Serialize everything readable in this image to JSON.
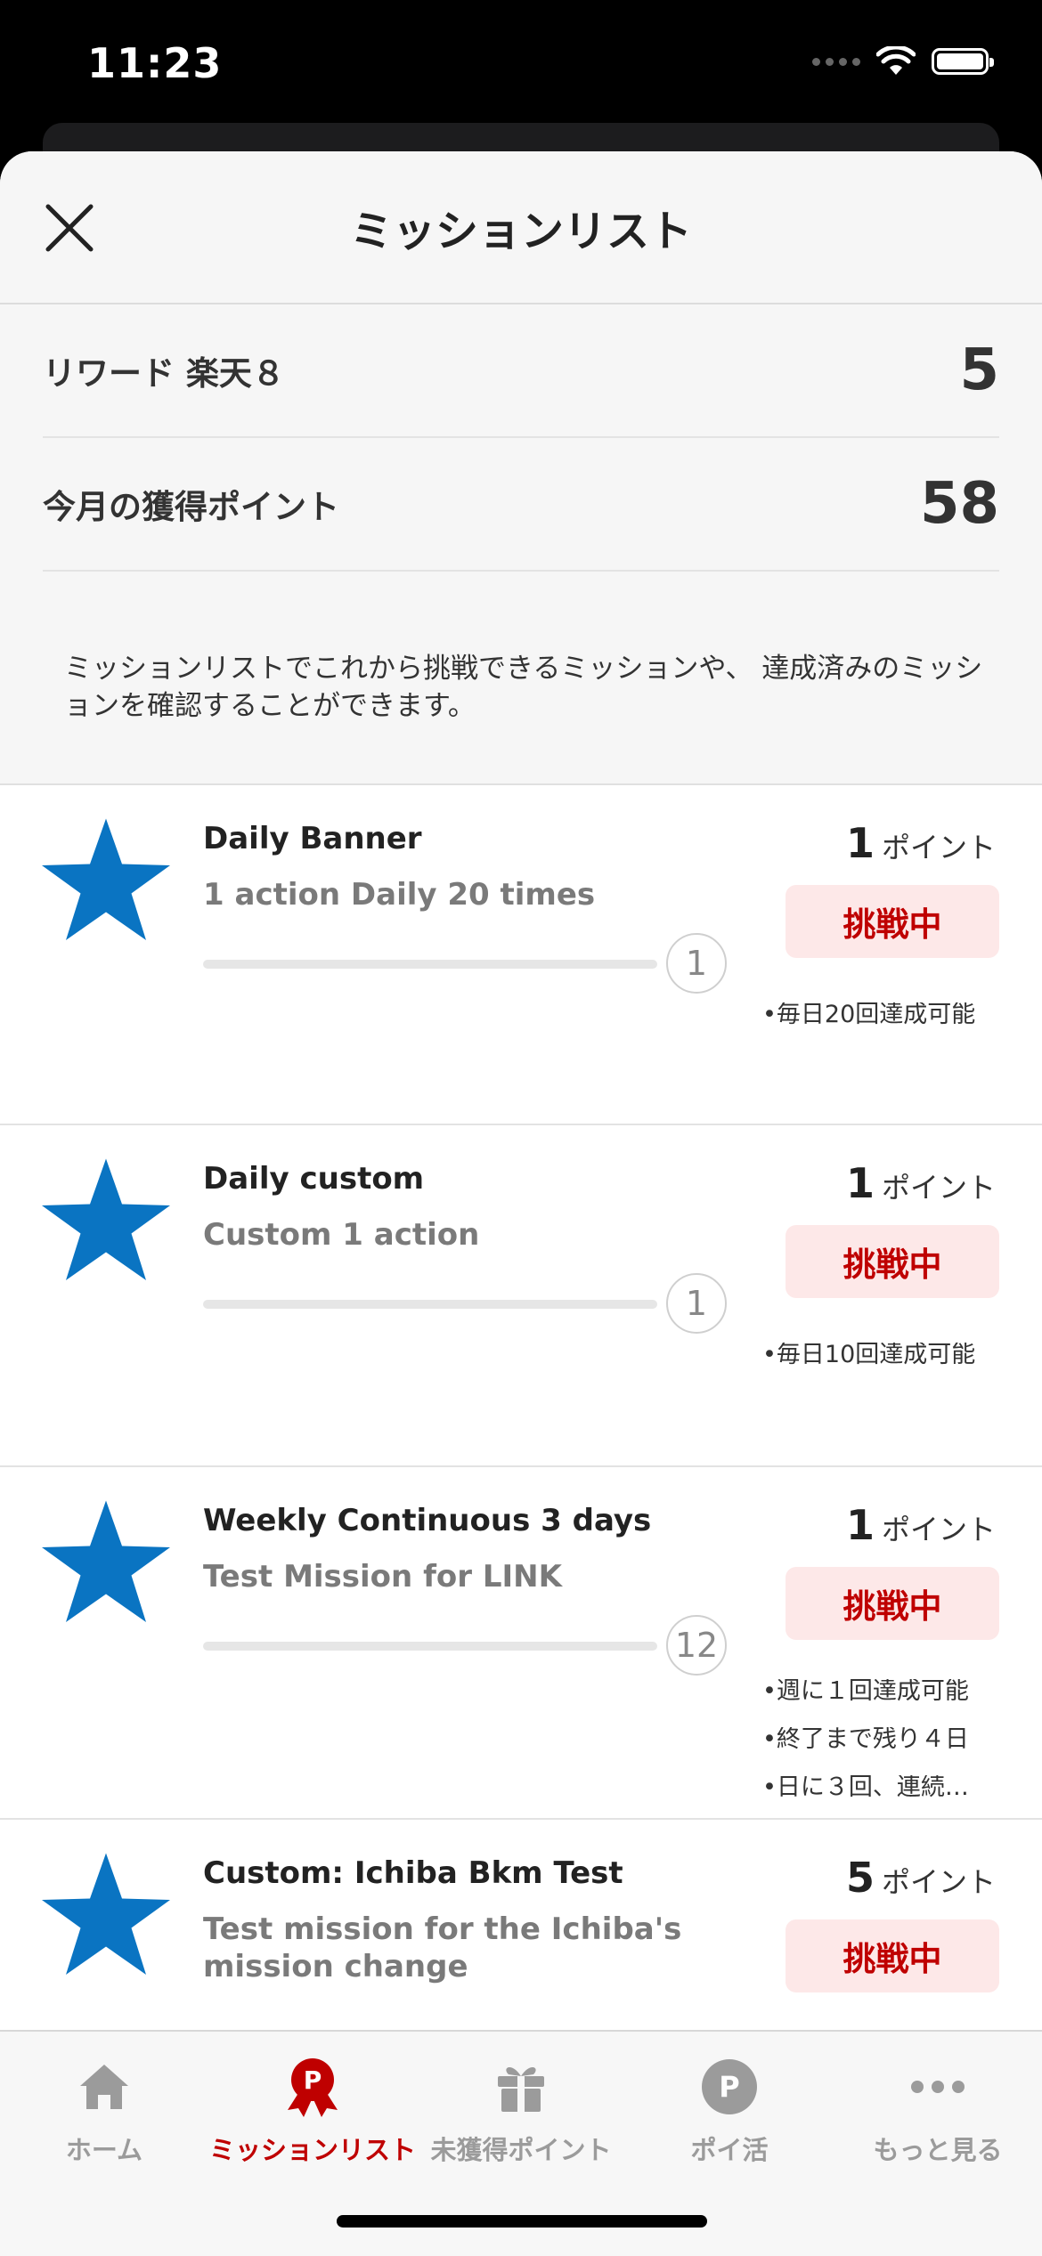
{
  "status_bar": {
    "time": "11:23"
  },
  "header": {
    "title": "ミッションリスト"
  },
  "summary": [
    {
      "label": "リワード 楽天８",
      "value": "5"
    },
    {
      "label": "今月の獲得ポイント",
      "value": "58"
    }
  ],
  "description": "ミッションリストでこれから挑戦できるミッションや、 達成済みのミッションを確認することができます。",
  "colors": {
    "accent": "#bf0000",
    "star": "#0a74c2",
    "status_bg": "#fde8e8"
  },
  "missions": [
    {
      "title": "Daily Banner",
      "subtitle": "1 action  Daily 20 times",
      "count": "1",
      "points": "1",
      "points_unit": "ポイント",
      "status": "挑戦中",
      "progress": 0,
      "notes": [
        "•毎日20回達成可能"
      ]
    },
    {
      "title": "Daily custom",
      "subtitle": "Custom  1 action",
      "count": "1",
      "points": "1",
      "points_unit": "ポイント",
      "status": "挑戦中",
      "progress": 0,
      "notes": [
        "•毎日10回達成可能"
      ]
    },
    {
      "title": "Weekly Continuous 3 days",
      "subtitle": "Test Mission for LINK",
      "count": "12",
      "points": "1",
      "points_unit": "ポイント",
      "status": "挑戦中",
      "progress": 0,
      "notes": [
        "•週に１回達成可能",
        "•終了まで残り４日",
        "•日に３回、連続…"
      ]
    },
    {
      "title": "Custom: Ichiba Bkm Test",
      "subtitle": "Test mission for the Ichiba's mission change",
      "points": "5",
      "points_unit": "ポイント",
      "status": "挑戦中"
    }
  ],
  "tabs": [
    {
      "label": "ホーム",
      "icon": "home-icon",
      "active": false
    },
    {
      "label": "ミッションリスト",
      "icon": "mission-ribbon-icon",
      "active": true
    },
    {
      "label": "未獲得ポイント",
      "icon": "gift-icon",
      "active": false
    },
    {
      "label": "ポイ活",
      "icon": "point-circle-icon",
      "active": false
    },
    {
      "label": "もっと見る",
      "icon": "more-dots-icon",
      "active": false
    }
  ]
}
